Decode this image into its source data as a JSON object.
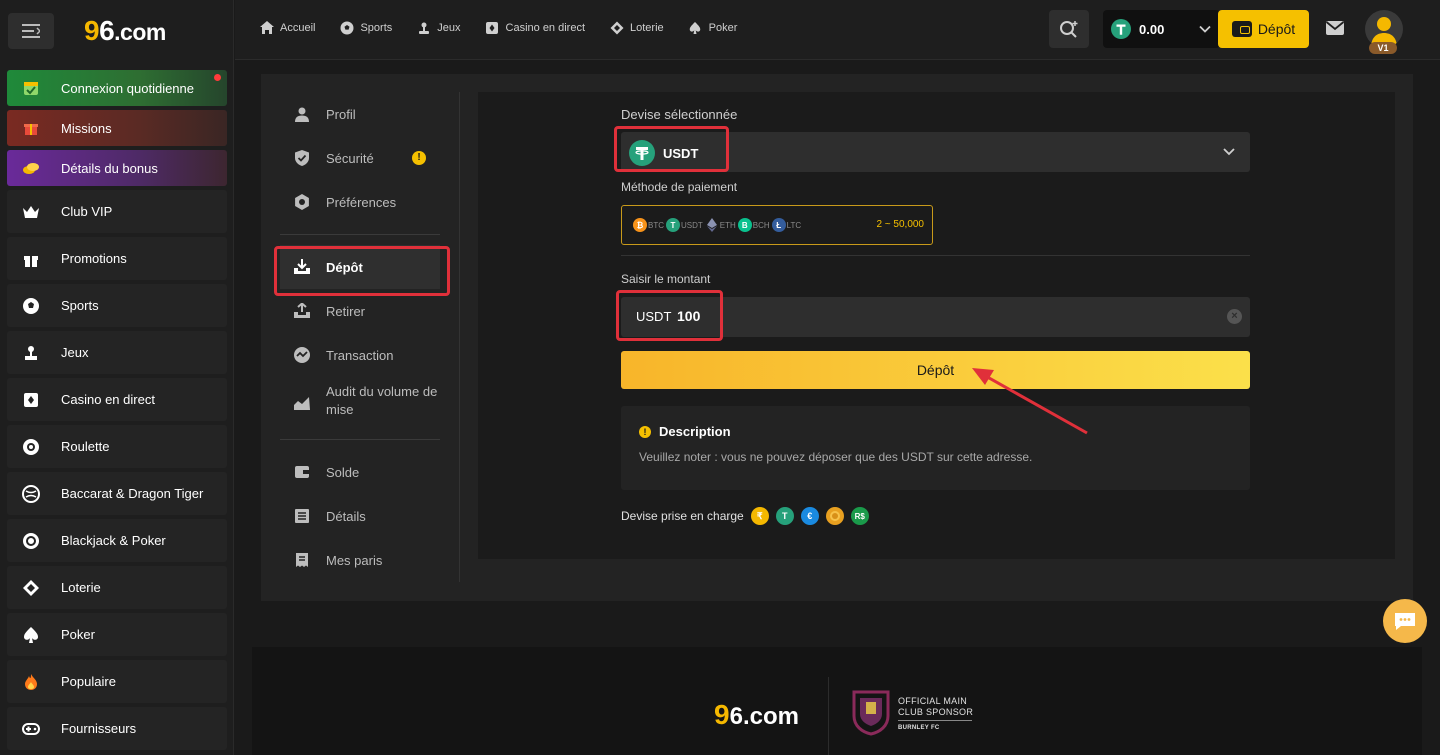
{
  "brand": {
    "logo_nine": "9",
    "logo_six": "6",
    "logo_rest": ".com"
  },
  "sidebar": {
    "items": [
      {
        "label": "Connexion quotidienne",
        "icon": "calendar-check-icon"
      },
      {
        "label": "Missions",
        "icon": "gift-box-icon"
      },
      {
        "label": "Détails du bonus",
        "icon": "coins-icon"
      },
      {
        "label": "Club VIP",
        "icon": "crown-icon"
      },
      {
        "label": "Promotions",
        "icon": "gift-icon"
      },
      {
        "label": "Sports",
        "icon": "soccer-ball-icon"
      },
      {
        "label": "Jeux",
        "icon": "joystick-icon"
      },
      {
        "label": "Casino en direct",
        "icon": "cards-icon"
      },
      {
        "label": "Roulette",
        "icon": "roulette-icon"
      },
      {
        "label": "Baccarat & Dragon Tiger",
        "icon": "globe-icon"
      },
      {
        "label": "Blackjack & Poker",
        "icon": "poker-chip-icon"
      },
      {
        "label": "Loterie",
        "icon": "ticket-icon"
      },
      {
        "label": "Poker",
        "icon": "spade-icon"
      },
      {
        "label": "Populaire",
        "icon": "fire-icon"
      },
      {
        "label": "Fournisseurs",
        "icon": "gamepad-icon"
      }
    ]
  },
  "topnav": {
    "items": [
      {
        "label": "Accueil",
        "icon": "home-icon"
      },
      {
        "label": "Sports",
        "icon": "soccer-ball-icon"
      },
      {
        "label": "Jeux",
        "icon": "joystick-icon"
      },
      {
        "label": "Casino en direct",
        "icon": "cards-icon"
      },
      {
        "label": "Loterie",
        "icon": "ticket-icon"
      },
      {
        "label": "Poker",
        "icon": "spade-icon"
      }
    ],
    "balance": "0.00",
    "deposit_label": "Dépôt",
    "vip_badge": "V1"
  },
  "account_menu": {
    "items": [
      {
        "label": "Profil",
        "icon": "user-icon"
      },
      {
        "label": "Sécurité",
        "icon": "shield-icon"
      },
      {
        "label": "Préférences",
        "icon": "settings-icon"
      },
      {
        "label": "Dépôt",
        "icon": "download-tray-icon"
      },
      {
        "label": "Retirer",
        "icon": "upload-tray-icon"
      },
      {
        "label": "Transaction",
        "icon": "transaction-icon"
      },
      {
        "label": "Audit du volume de mise",
        "icon": "chart-icon"
      },
      {
        "label": "Solde",
        "icon": "wallet-icon"
      },
      {
        "label": "Détails",
        "icon": "list-icon"
      },
      {
        "label": "Mes paris",
        "icon": "receipt-icon"
      }
    ],
    "warning_mark": "!"
  },
  "deposit": {
    "currency_label": "Devise sélectionnée",
    "currency_value": "USDT",
    "payment_label": "Méthode de paiement",
    "methods": [
      "BTC",
      "USDT",
      "ETH",
      "BCH",
      "LTC"
    ],
    "range": "2 ~ 50,000",
    "amount_label": "Saisir le montant",
    "amount_currency": "USDT",
    "amount_value": "100",
    "button_label": "Dépôt",
    "description_title": "Description",
    "description_body": "Veuillez noter : vous ne pouvez déposer que des USDT sur cette adresse.",
    "supported_label": "Devise prise en charge",
    "supported_currencies": [
      "₹",
      "T",
      "€",
      "",
      "R$"
    ]
  },
  "footer": {
    "sponsor_line1": "OFFICIAL MAIN",
    "sponsor_line2": "CLUB SPONSOR",
    "sponsor_club": "BURNLEY FC"
  },
  "colors": {
    "accent": "#f5c000",
    "highlight": "#e0303a",
    "tether": "#26a17b"
  }
}
